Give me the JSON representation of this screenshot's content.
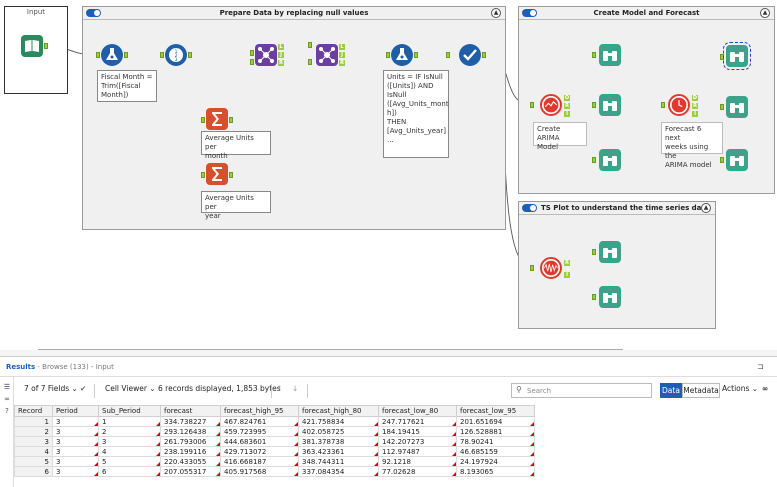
{
  "canvas": {
    "input_box": {
      "title": "Input"
    },
    "containers": {
      "prepare": {
        "title": "Prepare Data by replacing null values"
      },
      "model": {
        "title": "Create Model and Forecast"
      },
      "tsplot": {
        "title": "TS Plot to understand the time series data"
      }
    },
    "annotations": {
      "fiscal_month": [
        "Fiscal Month =",
        "Trim([Fiscal",
        "Month])"
      ],
      "avg_month": [
        "Average Units per",
        "month"
      ],
      "avg_year": [
        "Average Units per",
        "year"
      ],
      "units_formula": [
        "Units = IF IsNull",
        "([Units]) AND",
        "IsNull",
        "([Avg_Units_mont",
        "h])",
        "THEN",
        "[Avg_Units_year]",
        "..."
      ],
      "create_arima": [
        "Create ARIMA",
        "Model"
      ],
      "forecast": [
        "Forecast 6 next",
        "weeks using the",
        "ARIMA model"
      ]
    },
    "port_labels": {
      "join": [
        "L",
        "J",
        "R"
      ],
      "arima": [
        "O",
        "R",
        "I"
      ],
      "forecast": [
        "D",
        "R",
        "I"
      ],
      "tsplot": [
        "R",
        "I"
      ]
    }
  },
  "results": {
    "title": "Results",
    "subtitle": " - Browse (133) - Input",
    "toolbar": {
      "fields": "7 of 7 Fields",
      "viewer": "Cell Viewer",
      "records_info": "6 records displayed, 1,853 bytes",
      "search_placeholder": "Search",
      "tab_data": "Data",
      "tab_metadata": "Metadata",
      "actions": "Actions",
      "more": "∞"
    },
    "columns": [
      "Record",
      "Period",
      "Sub_Period",
      "forecast",
      "forecast_high_95",
      "forecast_high_80",
      "forecast_low_80",
      "forecast_low_95"
    ],
    "rows": [
      [
        "1",
        "3",
        "1",
        "334.738227",
        "467.824761",
        "421.758834",
        "247.717621",
        "201.651694"
      ],
      [
        "2",
        "3",
        "2",
        "293.126438",
        "459.723995",
        "402.058725",
        "184.19415",
        "126.528881"
      ],
      [
        "3",
        "3",
        "3",
        "261.793006",
        "444.683601",
        "381.378738",
        "142.207273",
        "78.90241"
      ],
      [
        "4",
        "3",
        "4",
        "238.199116",
        "429.713072",
        "363.423361",
        "112.97487",
        "46.685159"
      ],
      [
        "5",
        "3",
        "5",
        "220.433055",
        "416.668187",
        "348.744311",
        "92.1218",
        "24.197924"
      ],
      [
        "6",
        "3",
        "6",
        "207.055317",
        "405.917568",
        "337.084354",
        "77.02628",
        "8.193065"
      ]
    ]
  },
  "colors": {
    "accent": "#1e5fb4",
    "port": "#9ccc42",
    "input_tool": "#2a8a5c",
    "prep_tool": "#1f5fa8",
    "join_tool": "#6a3fa0",
    "summarize_tool": "#d6502e",
    "predictive_tool": "#e03a2e",
    "browse_tool": "#3aa38a"
  }
}
